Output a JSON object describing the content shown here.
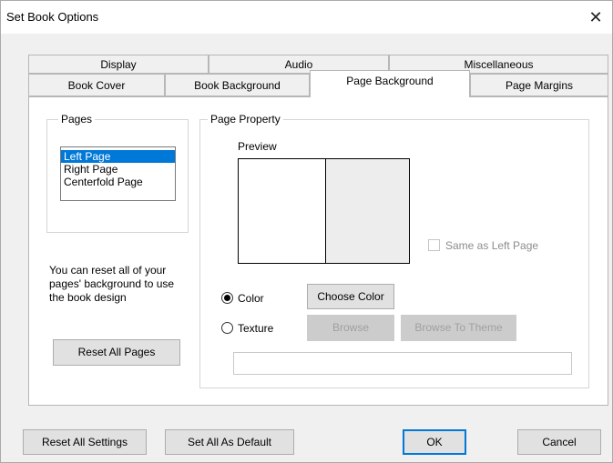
{
  "window": {
    "title": "Set Book Options",
    "close_glyph": "✕"
  },
  "tabs_row1": [
    "Display",
    "Audio",
    "Miscellaneous"
  ],
  "tabs_row2": [
    "Book Cover",
    "Book Background",
    "Page Background",
    "Page Margins"
  ],
  "pages_group": {
    "title": "Pages",
    "items": [
      "Left Page",
      "Right Page",
      "Centerfold Page"
    ],
    "selected": "Left Page",
    "reset_text": "You can reset all of your pages' background to use the book design",
    "reset_button": "Reset All Pages"
  },
  "page_property": {
    "title": "Page Property",
    "preview_label": "Preview",
    "same_as_left": "Same as Left Page",
    "color_label": "Color",
    "texture_label": "Texture",
    "choose_color": "Choose Color",
    "browse": "Browse",
    "browse_theme": "Browse To Theme",
    "path_value": ""
  },
  "footer": {
    "reset_all_settings": "Reset All Settings",
    "set_all_default": "Set All As Default",
    "ok": "OK",
    "cancel": "Cancel"
  },
  "colors": {
    "selection": "#0078d7",
    "preview_right": "#ededed"
  }
}
